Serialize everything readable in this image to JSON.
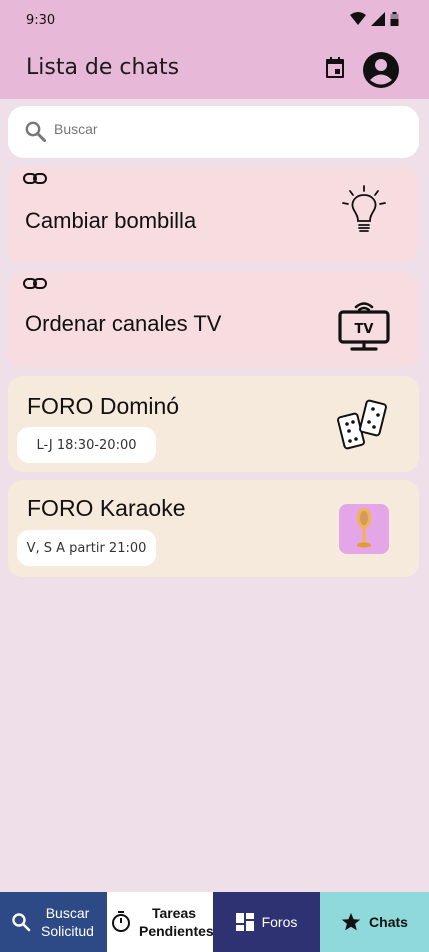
{
  "status_bar": {
    "time": "9:30"
  },
  "app_bar": {
    "title": "Lista de chats"
  },
  "search": {
    "placeholder": "Buscar"
  },
  "chats": [
    {
      "title": "Cambiar bombilla",
      "icon": "lightbulb-icon",
      "linked": true
    },
    {
      "title": "Ordenar canales TV",
      "icon": "tv-icon",
      "linked": true
    },
    {
      "title": "FORO Dominó",
      "schedule": "L-J 18:30-20:00",
      "icon": "dominoes-icon"
    },
    {
      "title": "FORO Karaoke",
      "schedule": "V, S A partir 21:00",
      "icon": "microphone-image"
    }
  ],
  "nav": [
    {
      "label": "Buscar Solicitud",
      "icon": "search-icon",
      "color": "#2e4a86"
    },
    {
      "label": "Tareas Pendientes",
      "icon": "timer-icon",
      "color": "#ffffff"
    },
    {
      "label": "Foros",
      "icon": "dashboard-icon",
      "color": "#2e3272"
    },
    {
      "label": "Chats",
      "icon": "star-icon",
      "color": "#8fd9da"
    }
  ]
}
